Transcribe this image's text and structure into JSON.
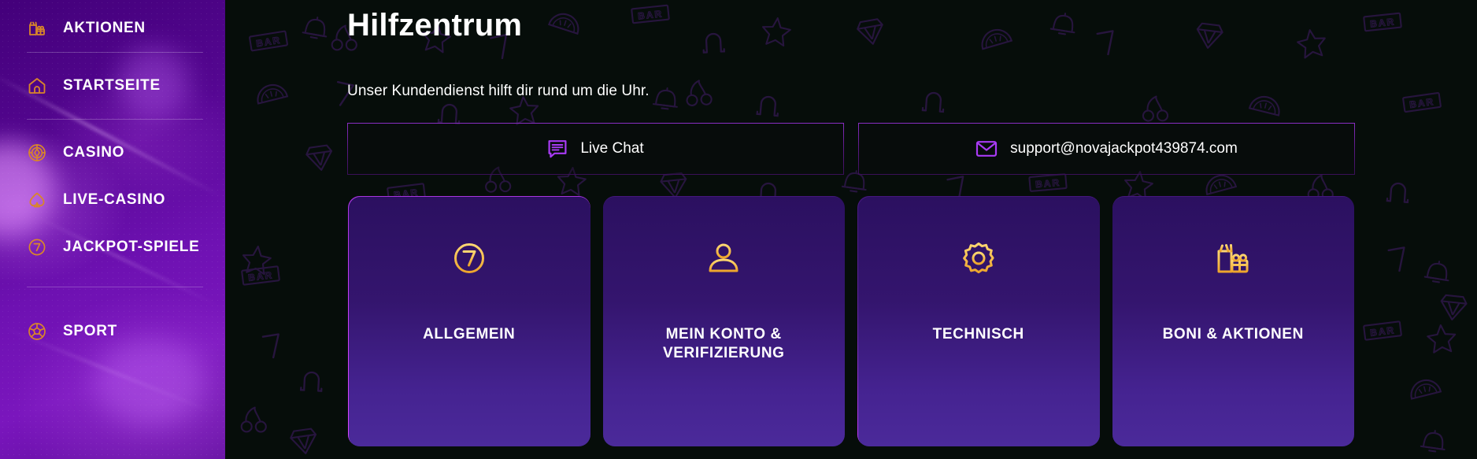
{
  "sidebar": {
    "items": [
      {
        "label": "AKTIONEN",
        "icon": "gift-icon",
        "name": "sidebar-item-aktionen"
      },
      {
        "label": "STARTSEITE",
        "icon": "home-icon",
        "name": "sidebar-item-startseite"
      },
      {
        "label": "CASINO",
        "icon": "chip-icon",
        "name": "sidebar-item-casino"
      },
      {
        "label": "LIVE-CASINO",
        "icon": "spade-icon",
        "name": "sidebar-item-live-casino"
      },
      {
        "label": "JACKPOT-SPIELE",
        "icon": "seven-icon",
        "name": "sidebar-item-jackpot-spiele"
      },
      {
        "label": "SPORT",
        "icon": "football-icon",
        "name": "sidebar-item-sport"
      }
    ]
  },
  "main": {
    "title": "Hilfzentrum",
    "subtitle": "Unser Kundendienst hilft dir rund um die Uhr.",
    "contacts": [
      {
        "label": "Live Chat",
        "icon": "chat-bubble-icon"
      },
      {
        "label": "support@novajackpot439874.com",
        "icon": "envelope-icon"
      }
    ],
    "cards": [
      {
        "label": "ALLGEMEIN",
        "icon": "seven-circle-icon",
        "active": true
      },
      {
        "label": "MEIN KONTO & VERIFIZIERUNG",
        "icon": "user-icon",
        "active": false
      },
      {
        "label": "TECHNISCH",
        "icon": "gear-icon",
        "active": false
      },
      {
        "label": "BONI & AKTIONEN",
        "icon": "gift-icon",
        "active": false
      }
    ]
  },
  "colors": {
    "gold": "#F0B33C",
    "gold_light": "#FFD36B",
    "accent_purple": "#A93BF5",
    "sidebar_purple": "#6E11B2",
    "card_bg": "#3A1A7C",
    "page_bg": "#060D0A",
    "text": "#FFFFFF"
  }
}
